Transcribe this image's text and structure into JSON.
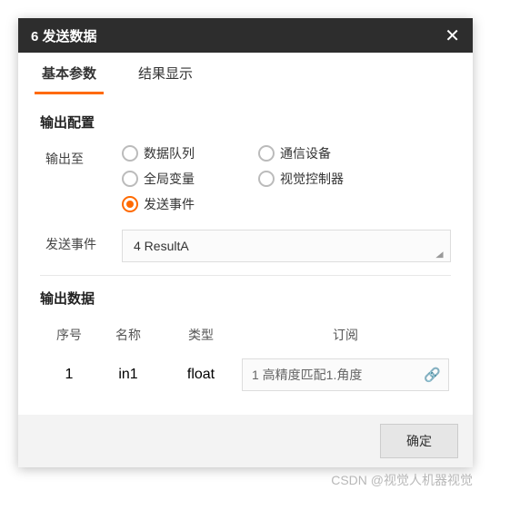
{
  "dialog": {
    "title": "6 发送数据",
    "close": "✕"
  },
  "tabs": {
    "basic": "基本参数",
    "result": "结果显示"
  },
  "section_output_config": "输出配置",
  "output_to_label": "输出至",
  "send_event_label": "发送事件",
  "radios": {
    "data_queue": "数据队列",
    "comm_device": "通信设备",
    "global_var": "全局变量",
    "vision_ctrl": "视觉控制器",
    "send_event": "发送事件"
  },
  "event_select": "4 ResultA",
  "section_output_data": "输出数据",
  "headers": {
    "index": "序号",
    "name": "名称",
    "type": "类型",
    "subscribe": "订阅"
  },
  "rows": [
    {
      "index": "1",
      "name": "in1",
      "type": "float",
      "subscribe": "1 高精度匹配1.角度"
    }
  ],
  "footer": {
    "ok": "确定"
  },
  "watermark": "CSDN @视觉人机器视觉"
}
